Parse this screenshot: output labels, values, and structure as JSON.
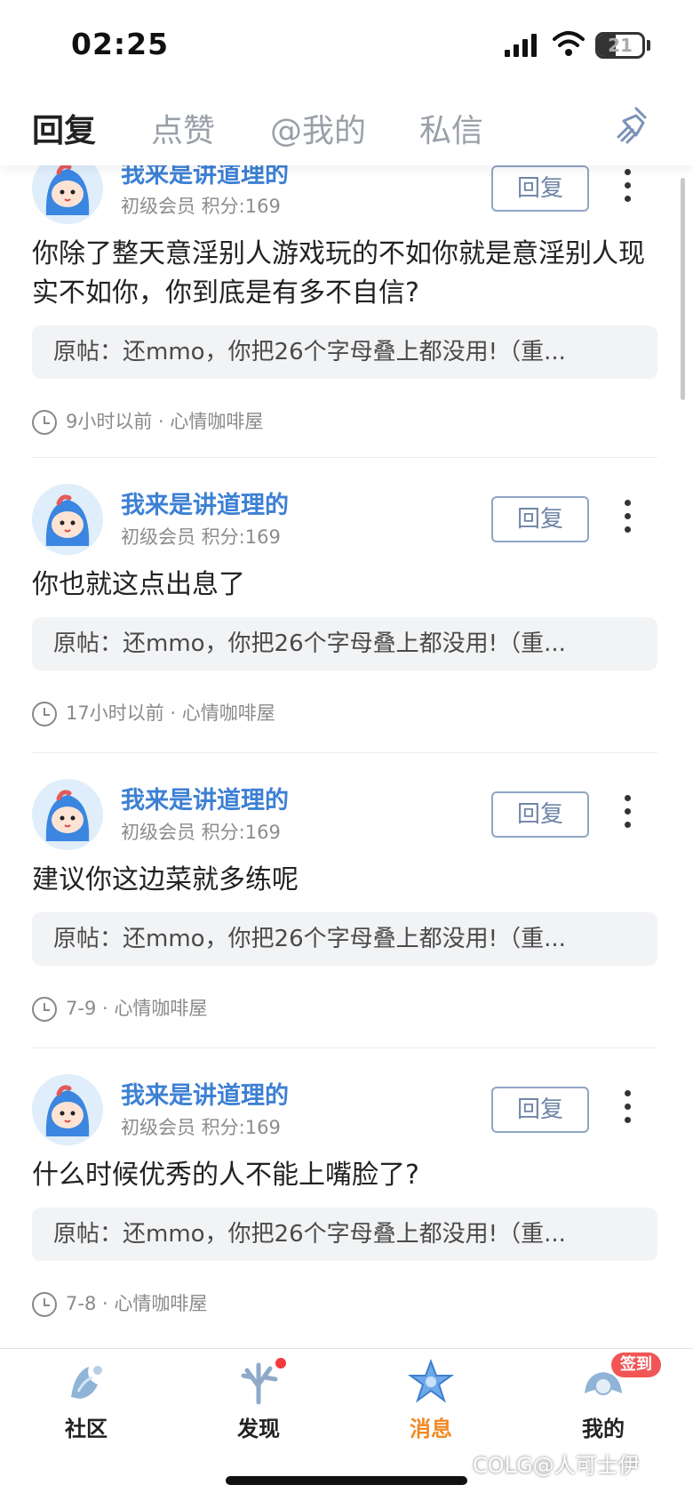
{
  "status_bar": {
    "time": "02:25",
    "battery": "21"
  },
  "tabs": [
    {
      "label": "回复",
      "active": true
    },
    {
      "label": "点赞",
      "active": false
    },
    {
      "label": "@我的",
      "active": false
    },
    {
      "label": "私信",
      "active": false
    }
  ],
  "reply_label": "回复",
  "items": [
    {
      "username": "我来是讲道理的",
      "member": "初级会员 积分:169",
      "content": "你除了整天意淫别人游戏玩的不如你就是意淫别人现实不如你，你到底是有多不自信?",
      "original": "原帖：还mmo，你把26个字母叠上都没用!（重...",
      "meta": "9小时以前 · 心情咖啡屋"
    },
    {
      "username": "我来是讲道理的",
      "member": "初级会员 积分:169",
      "content": "你也就这点出息了",
      "original": "原帖：还mmo，你把26个字母叠上都没用!（重...",
      "meta": "17小时以前 · 心情咖啡屋"
    },
    {
      "username": "我来是讲道理的",
      "member": "初级会员 积分:169",
      "content": "建议你这边菜就多练呢",
      "original": "原帖：还mmo，你把26个字母叠上都没用!（重...",
      "meta": "7-9 · 心情咖啡屋"
    },
    {
      "username": "我来是讲道理的",
      "member": "初级会员 积分:169",
      "content": "什么时候优秀的人不能上嘴脸了?",
      "original": "原帖：还mmo，你把26个字母叠上都没用!（重...",
      "meta": "7-8 · 心情咖啡屋"
    }
  ],
  "nav": [
    {
      "label": "社区",
      "icon": "community-icon"
    },
    {
      "label": "发现",
      "icon": "discover-icon"
    },
    {
      "label": "消息",
      "icon": "message-icon"
    },
    {
      "label": "我的",
      "icon": "profile-icon",
      "badge": "签到"
    }
  ],
  "watermark": "COLG@人可士伊",
  "colors": {
    "accent": "#f08a24",
    "link": "#3d80d4",
    "badge": "#f25555"
  }
}
